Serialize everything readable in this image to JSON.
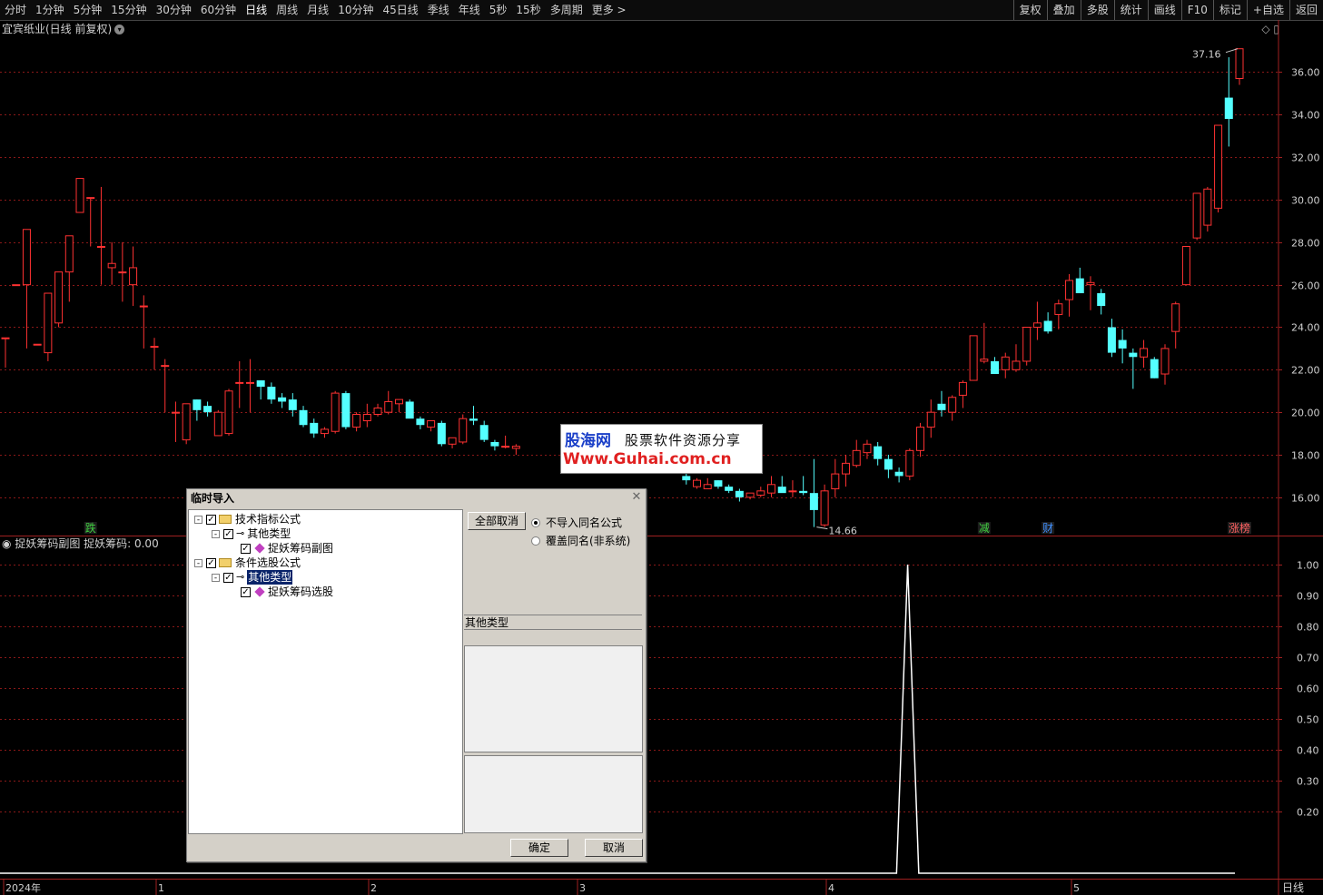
{
  "toolbar": {
    "periods": [
      "分时",
      "1分钟",
      "5分钟",
      "15分钟",
      "30分钟",
      "60分钟",
      "日线",
      "周线",
      "月线",
      "10分钟",
      "45日线",
      "季线",
      "年线",
      "5秒",
      "15秒",
      "多周期",
      "更多 >"
    ],
    "active_period": "日线",
    "tools": [
      "复权",
      "叠加",
      "多股",
      "统计",
      "画线",
      "F10",
      "标记",
      "+自选",
      "返回"
    ]
  },
  "main_chart": {
    "title": "宜宾纸业(日线 前复权)",
    "max_label": "37.16",
    "min_label": "14.66",
    "markers": [
      {
        "text": "跌",
        "color": "#40d040"
      },
      {
        "text": "减",
        "color": "#40d040"
      },
      {
        "text": "财",
        "color": "#4090ff"
      },
      {
        "text": "涨榜",
        "color": "#ff6060"
      }
    ]
  },
  "sub_chart": {
    "title": "捉妖筹码副图 捉妖筹码: 0.00"
  },
  "time_axis": {
    "labels": [
      "2024年",
      "1",
      "2",
      "3",
      "4",
      "5"
    ],
    "right_label": "日线"
  },
  "chart_data": [
    {
      "type": "candlestick",
      "title": "宜宾纸业(日线 前复权)",
      "ylabel": "",
      "ylim": [
        14.2,
        37.6
      ],
      "yticks": [
        16,
        18,
        20,
        22,
        24,
        26,
        28,
        30,
        32,
        34,
        36
      ],
      "tick_labels": [
        "16.00",
        "18.00",
        "20.00",
        "22.00",
        "24.00",
        "26.00",
        "28.00",
        "30.00",
        "32.00",
        "34.00",
        "36.00"
      ],
      "up_color": "#ff3232",
      "down_color": "#54ffff",
      "grid": true,
      "candles": [
        [
          23.5,
          23.5,
          22.1,
          23.5
        ],
        [
          26.0,
          26.0,
          26.0,
          26.0
        ],
        [
          26.0,
          28.6,
          23.0,
          28.6
        ],
        [
          23.2,
          23.2,
          23.2,
          23.2
        ],
        [
          22.8,
          25.6,
          22.4,
          25.6
        ],
        [
          24.2,
          26.5,
          24.0,
          26.6
        ],
        [
          26.6,
          28.3,
          25.2,
          28.3
        ],
        [
          29.4,
          31.0,
          29.4,
          31.0
        ],
        [
          30.1,
          30.1,
          27.8,
          30.1
        ],
        [
          27.8,
          30.6,
          26.0,
          27.8
        ],
        [
          26.8,
          28.0,
          26.0,
          27.0
        ],
        [
          26.6,
          28.0,
          25.2,
          26.6
        ],
        [
          26.0,
          27.8,
          25.0,
          26.8
        ],
        [
          25.0,
          25.5,
          23.0,
          25.0
        ],
        [
          23.1,
          23.5,
          22.0,
          23.1
        ],
        [
          22.2,
          22.5,
          20.0,
          22.2
        ],
        [
          20.0,
          20.5,
          18.6,
          20.0
        ],
        [
          18.7,
          20.4,
          18.5,
          20.4
        ],
        [
          20.6,
          20.6,
          19.6,
          20.1
        ],
        [
          20.3,
          20.5,
          19.8,
          20.0
        ],
        [
          18.9,
          20.1,
          18.9,
          20.0
        ],
        [
          19.0,
          21.1,
          18.9,
          21.0
        ],
        [
          21.4,
          22.4,
          20.2,
          21.4
        ],
        [
          21.4,
          22.5,
          20.0,
          21.4
        ],
        [
          21.5,
          21.5,
          20.6,
          21.2
        ],
        [
          21.2,
          21.4,
          20.4,
          20.6
        ],
        [
          20.7,
          20.9,
          20.2,
          20.5
        ],
        [
          20.6,
          20.9,
          19.8,
          20.1
        ],
        [
          20.1,
          20.3,
          19.3,
          19.4
        ],
        [
          19.5,
          19.7,
          18.8,
          19.0
        ],
        [
          19.0,
          19.3,
          18.8,
          19.2
        ],
        [
          19.1,
          21.0,
          19.0,
          20.9
        ],
        [
          20.9,
          21.0,
          19.2,
          19.3
        ],
        [
          19.3,
          20.0,
          19.1,
          19.9
        ],
        [
          19.6,
          20.4,
          19.3,
          19.9
        ],
        [
          19.9,
          20.4,
          19.8,
          20.2
        ],
        [
          20.0,
          21.0,
          19.9,
          20.5
        ],
        [
          20.4,
          20.6,
          20.0,
          20.6
        ],
        [
          20.5,
          20.6,
          19.8,
          19.7
        ],
        [
          19.7,
          19.8,
          19.2,
          19.4
        ],
        [
          19.3,
          19.5,
          19.1,
          19.6
        ],
        [
          19.5,
          19.6,
          18.4,
          18.5
        ],
        [
          18.5,
          18.7,
          18.3,
          18.8
        ],
        [
          18.6,
          19.9,
          18.5,
          19.7
        ],
        [
          19.7,
          20.3,
          19.4,
          19.6
        ],
        [
          19.4,
          19.6,
          18.6,
          18.7
        ],
        [
          18.6,
          18.7,
          18.2,
          18.4
        ],
        [
          18.4,
          18.9,
          18.3,
          18.4
        ],
        [
          18.3,
          18.5,
          18.0,
          18.4
        ],
        [
          18.3,
          18.3,
          18.3,
          18.3
        ],
        [
          18.3,
          18.3,
          18.3,
          18.3
        ],
        [
          18.3,
          18.3,
          18.3,
          18.3
        ],
        [
          18.3,
          18.3,
          18.3,
          18.3
        ],
        [
          18.3,
          18.3,
          18.3,
          18.3
        ],
        [
          18.3,
          18.3,
          18.3,
          18.3
        ],
        [
          18.3,
          18.3,
          18.3,
          18.3
        ],
        [
          18.3,
          18.3,
          18.3,
          18.3
        ],
        [
          18.3,
          18.3,
          18.3,
          18.3
        ],
        [
          18.3,
          18.3,
          18.3,
          18.3
        ],
        [
          18.3,
          18.3,
          18.3,
          18.3
        ],
        [
          18.3,
          18.3,
          18.3,
          18.3
        ],
        [
          18.3,
          18.3,
          18.3,
          18.3
        ],
        [
          18.3,
          18.3,
          18.3,
          18.3
        ],
        [
          18.3,
          18.3,
          18.3,
          18.3
        ],
        [
          17.0,
          17.3,
          16.6,
          16.8
        ],
        [
          16.5,
          16.9,
          16.4,
          16.8
        ],
        [
          16.4,
          16.9,
          16.4,
          16.6
        ],
        [
          16.8,
          16.8,
          16.4,
          16.5
        ],
        [
          16.5,
          16.6,
          16.2,
          16.3
        ],
        [
          16.3,
          16.4,
          15.8,
          16.0
        ],
        [
          16.0,
          16.2,
          15.9,
          16.2
        ],
        [
          16.1,
          16.5,
          16.0,
          16.3
        ],
        [
          16.2,
          17.0,
          16.0,
          16.6
        ],
        [
          16.5,
          17.0,
          16.4,
          16.2
        ],
        [
          16.3,
          16.8,
          16.0,
          16.3
        ],
        [
          16.3,
          17.0,
          16.1,
          16.2
        ],
        [
          16.2,
          17.8,
          14.6,
          15.4
        ],
        [
          14.7,
          16.6,
          14.6,
          16.3
        ],
        [
          16.4,
          17.8,
          16.0,
          17.1
        ],
        [
          17.1,
          18.0,
          16.5,
          17.6
        ],
        [
          17.5,
          18.7,
          17.4,
          18.2
        ],
        [
          18.1,
          18.7,
          17.8,
          18.5
        ],
        [
          18.4,
          18.6,
          17.5,
          17.8
        ],
        [
          17.8,
          18.0,
          16.9,
          17.3
        ],
        [
          17.2,
          17.4,
          16.7,
          17.0
        ],
        [
          17.0,
          18.3,
          16.8,
          18.2
        ],
        [
          18.2,
          19.5,
          17.9,
          19.3
        ],
        [
          19.3,
          20.6,
          18.8,
          20.0
        ],
        [
          20.4,
          21.0,
          19.8,
          20.1
        ],
        [
          20.0,
          20.8,
          19.6,
          20.7
        ],
        [
          20.8,
          21.5,
          20.2,
          21.4
        ],
        [
          21.5,
          23.6,
          21.5,
          23.6
        ],
        [
          22.4,
          24.2,
          22.3,
          22.5
        ],
        [
          22.4,
          22.6,
          21.8,
          21.8
        ],
        [
          22.0,
          22.8,
          21.6,
          22.6
        ],
        [
          22.0,
          23.2,
          21.9,
          22.4
        ],
        [
          22.4,
          24.0,
          22.2,
          24.0
        ],
        [
          24.0,
          25.2,
          23.4,
          24.2
        ],
        [
          24.3,
          24.7,
          23.7,
          23.8
        ],
        [
          24.6,
          25.3,
          23.9,
          25.1
        ],
        [
          25.3,
          26.5,
          24.5,
          26.2
        ],
        [
          26.3,
          26.8,
          25.6,
          25.6
        ],
        [
          26.0,
          26.4,
          24.8,
          26.1
        ],
        [
          25.6,
          25.8,
          24.6,
          25.0
        ],
        [
          24.0,
          24.4,
          22.6,
          22.8
        ],
        [
          23.4,
          23.9,
          22.3,
          23.0
        ],
        [
          22.8,
          23.0,
          21.1,
          22.6
        ],
        [
          22.6,
          23.4,
          22.1,
          23.0
        ],
        [
          22.5,
          22.6,
          21.6,
          21.6
        ],
        [
          21.8,
          23.2,
          21.3,
          23.0
        ],
        [
          23.8,
          25.2,
          23.0,
          25.1
        ],
        [
          26.0,
          26.0,
          26.0,
          27.8
        ],
        [
          28.2,
          28.6,
          28.1,
          30.3
        ],
        [
          28.8,
          30.6,
          28.5,
          30.5
        ],
        [
          29.6,
          33.5,
          29.4,
          33.5
        ],
        [
          34.8,
          36.7,
          32.5,
          33.8
        ],
        [
          35.7,
          37.1,
          35.4,
          37.1
        ]
      ]
    },
    {
      "type": "line",
      "title": "捉妖筹码副图",
      "series": [
        {
          "name": "捉妖筹码",
          "color": "#ffffff"
        }
      ],
      "ylim": [
        0.0,
        1.05
      ],
      "yticks": [
        0.2,
        0.3,
        0.4,
        0.5,
        0.6,
        0.7,
        0.8,
        0.9,
        1.0
      ],
      "tick_labels": [
        "0.20",
        "0.30",
        "0.40",
        "0.50",
        "0.60",
        "0.70",
        "0.80",
        "0.90",
        "1.00"
      ],
      "spike": {
        "at": 0.735,
        "width": 0.018,
        "value": 1.0,
        "baseline": 0.0
      }
    }
  ],
  "dialog": {
    "title": "临时导入",
    "tree": [
      {
        "label": "技术指标公式",
        "level": 0,
        "type": "folder",
        "expander": "-"
      },
      {
        "label": "其他类型",
        "level": 1,
        "type": "key",
        "expander": "-"
      },
      {
        "label": "捉妖筹码副图",
        "level": 2,
        "type": "item"
      },
      {
        "label": "条件选股公式",
        "level": 0,
        "type": "folder",
        "expander": "-"
      },
      {
        "label": "其他类型",
        "level": 1,
        "type": "key",
        "expander": "-",
        "selected": true
      },
      {
        "label": "捉妖筹码选股",
        "level": 2,
        "type": "item"
      }
    ],
    "cancel_all_label": "全部取消",
    "options": [
      {
        "label": "不导入同名公式",
        "checked": true
      },
      {
        "label": "覆盖同名(非系统)",
        "checked": false
      }
    ],
    "category_label": "其他类型",
    "ok_label": "确定",
    "cancel_label": "取消"
  },
  "watermark": {
    "logo": "股海网",
    "tagline": "股票软件资源分享",
    "url": "Www.Guhai.com.cn"
  }
}
